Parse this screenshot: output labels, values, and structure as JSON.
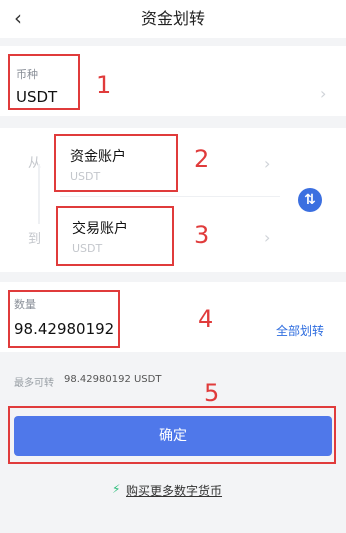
{
  "header": {
    "back_icon": "‹",
    "title": "资金划转"
  },
  "currency": {
    "label": "币种",
    "value": "USDT",
    "annotation_number": "1"
  },
  "transfer": {
    "from_label": "从",
    "to_label": "到",
    "from_account": {
      "name": "资金账户",
      "sub": "USDT",
      "annotation_number": "2"
    },
    "to_account": {
      "name": "交易账户",
      "sub": "USDT",
      "annotation_number": "3"
    },
    "swap_icon": "⇅"
  },
  "amount": {
    "label": "数量",
    "value": "98.42980192",
    "transfer_all": "全部划转",
    "annotation_number": "4"
  },
  "max_transfer": {
    "label": "最多可转",
    "value": "98.42980192 USDT"
  },
  "confirm": {
    "label": "确定",
    "annotation_number": "5"
  },
  "buy_more": {
    "icon": "⚡",
    "label": "购买更多数字货币"
  },
  "colors": {
    "accent": "#4f78ea",
    "annotation": "#e03b3b",
    "link": "#2d6cdf"
  }
}
